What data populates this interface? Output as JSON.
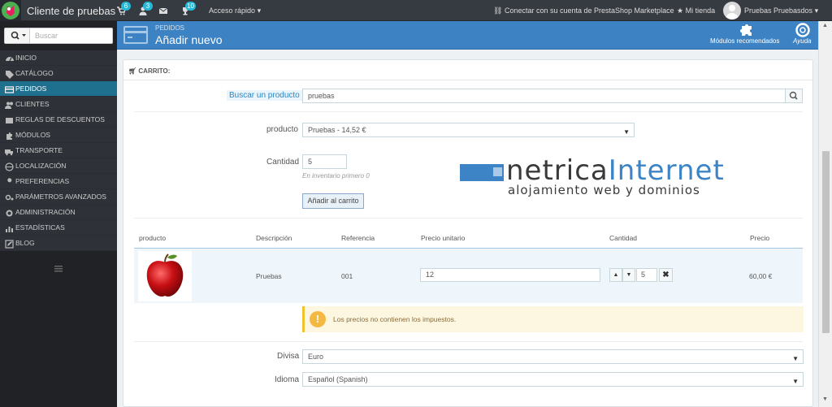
{
  "topbar": {
    "shop_name": "Cliente de pruebas",
    "orders_count": "6",
    "customers_count": "3",
    "messages_count": "",
    "trophy_count": "10",
    "quick_access": "Acceso rápido",
    "connect": "Conectar con su cuenta de PrestaShop Marketplace",
    "my_store": "Mi tienda",
    "user": "Pruebas Pruebasdos"
  },
  "sidebar": {
    "search_placeholder": "Buscar",
    "items": [
      {
        "label": "Inicio",
        "icon": "dashboard-icon"
      },
      {
        "label": "Catálogo",
        "icon": "tag-icon"
      },
      {
        "label": "Pedidos",
        "icon": "credit-card-icon",
        "active": true
      },
      {
        "label": "Clientes",
        "icon": "users-icon"
      },
      {
        "label": "Reglas de descuentos",
        "icon": "ticket-icon"
      },
      {
        "label": "Módulos",
        "icon": "puzzle-icon"
      },
      {
        "label": "Transporte",
        "icon": "truck-icon"
      },
      {
        "label": "Localización",
        "icon": "globe-icon"
      },
      {
        "label": "Preferencias",
        "icon": "wrench-icon"
      },
      {
        "label": "Parámetros avanzados",
        "icon": "cogs-icon"
      },
      {
        "label": "Administración",
        "icon": "gear-icon"
      },
      {
        "label": "Estadísticas",
        "icon": "chart-icon"
      },
      {
        "label": "Blog",
        "icon": "edit-icon"
      }
    ]
  },
  "header": {
    "breadcrumb": "Pedidos",
    "title": "Añadir nuevo",
    "recommended_modules": "Módulos recomendados",
    "help": "Ayuda"
  },
  "cart": {
    "heading": "Carrito:",
    "search_label": "Buscar un producto",
    "search_value": "pruebas",
    "product_label": "producto",
    "product_value": "Pruebas - 14,52 €",
    "quantity_label": "Cantidad",
    "quantity_value": "5",
    "stock_hint": "En inventario primero 0",
    "add_button": "Añadir al carrito"
  },
  "table": {
    "headers": [
      "producto",
      "Descripción",
      "Referencia",
      "Precio unitario",
      "Cantidad",
      "Precio"
    ],
    "row": {
      "description": "Pruebas",
      "reference": "001",
      "unit_price": "12",
      "quantity": "5",
      "price": "60,00 €"
    }
  },
  "alert": {
    "text": "Los precios no contienen los impuestos."
  },
  "currency": {
    "label": "Divisa",
    "value": "Euro"
  },
  "language": {
    "label": "Idioma",
    "value": "Español (Spanish)"
  },
  "watermark": {
    "word1": "netrica",
    "word2": "Internet",
    "tagline": "alojamiento web y dominios"
  },
  "colors": {
    "topbar": "#363a41",
    "header": "#3d83c4",
    "accent": "#25b9d7",
    "alert_bg": "#fdf6e0"
  }
}
